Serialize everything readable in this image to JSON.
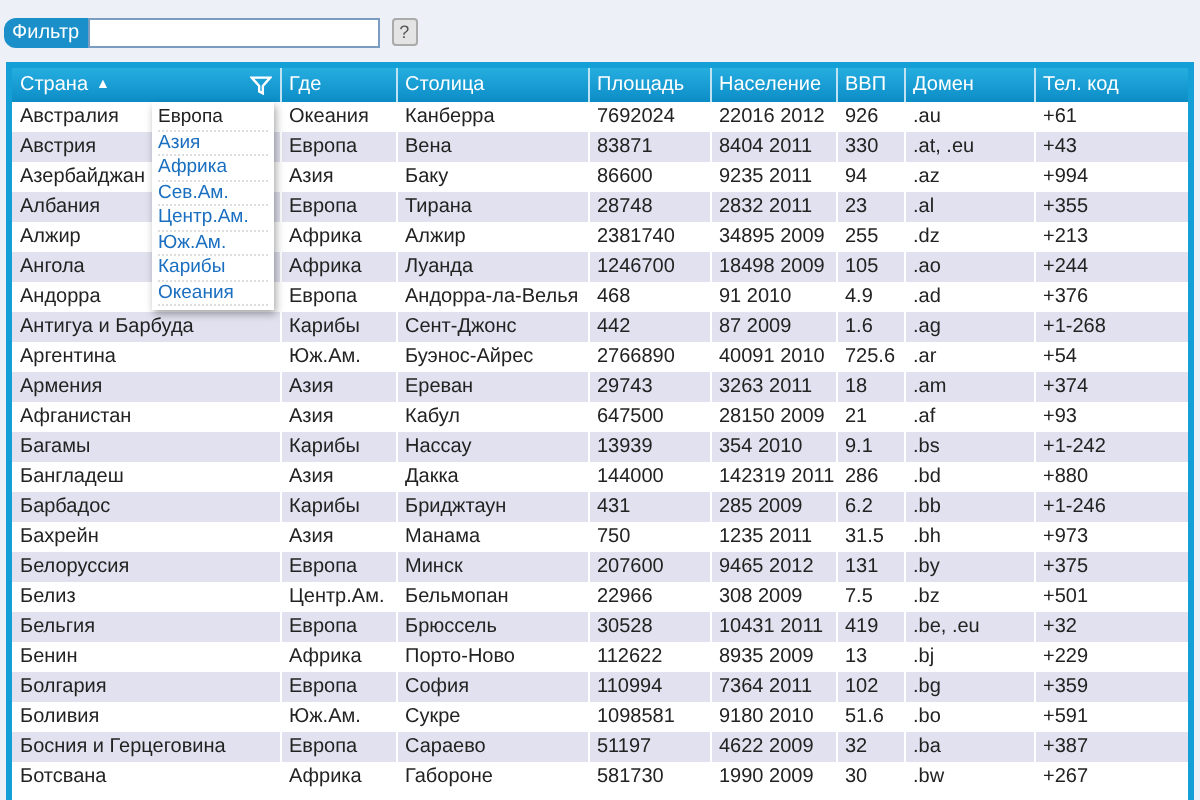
{
  "filter": {
    "label": "Фильтр",
    "help": "?"
  },
  "columns": [
    {
      "label": "Страна",
      "sort_mark": "▲",
      "filter": true
    },
    {
      "label": "Где",
      "filter": false
    },
    {
      "label": "Столица",
      "filter": false
    },
    {
      "label": "Площадь",
      "filter": false
    },
    {
      "label": "Население",
      "filter": false
    },
    {
      "label": "ВВП",
      "filter": false
    },
    {
      "label": "Домен",
      "filter": false
    },
    {
      "label": "Тел. код",
      "filter": false
    }
  ],
  "filter_menu": [
    {
      "label": "Европа",
      "selected": true
    },
    {
      "label": "Азия",
      "selected": false
    },
    {
      "label": "Африка",
      "selected": false
    },
    {
      "label": "Сев.Ам.",
      "selected": false
    },
    {
      "label": "Центр.Ам.",
      "selected": false
    },
    {
      "label": "Юж.Ам.",
      "selected": false
    },
    {
      "label": "Карибы",
      "selected": false
    },
    {
      "label": "Океания",
      "selected": false
    }
  ],
  "rows": [
    [
      "Австралия",
      "Океания",
      "Канберра",
      "7692024",
      "22016 2012",
      "926",
      ".au",
      "+61"
    ],
    [
      "Австрия",
      "Европа",
      "Вена",
      "83871",
      "8404 2011",
      "330",
      ".at, .eu",
      "+43"
    ],
    [
      "Азербайджан",
      "Азия",
      "Баку",
      "86600",
      "9235 2011",
      "94",
      ".az",
      "+994"
    ],
    [
      "Албания",
      "Европа",
      "Тирана",
      "28748",
      "2832 2011",
      "23",
      ".al",
      "+355"
    ],
    [
      "Алжир",
      "Африка",
      "Алжир",
      "2381740",
      "34895 2009",
      "255",
      ".dz",
      "+213"
    ],
    [
      "Ангола",
      "Африка",
      "Луанда",
      "1246700",
      "18498 2009",
      "105",
      ".ao",
      "+244"
    ],
    [
      "Андорра",
      "Европа",
      "Андорра-ла-Велья",
      "468",
      "91 2010",
      "4.9",
      ".ad",
      "+376"
    ],
    [
      "Антигуа и Барбуда",
      "Карибы",
      "Сент-Джонс",
      "442",
      "87 2009",
      "1.6",
      ".ag",
      "+1-268"
    ],
    [
      "Аргентина",
      "Юж.Ам.",
      "Буэнос-Айрес",
      "2766890",
      "40091 2010",
      "725.6",
      ".ar",
      "+54"
    ],
    [
      "Армения",
      "Азия",
      "Ереван",
      "29743",
      "3263 2011",
      "18",
      ".am",
      "+374"
    ],
    [
      "Афганистан",
      "Азия",
      "Кабул",
      "647500",
      "28150 2009",
      "21",
      ".af",
      "+93"
    ],
    [
      "Багамы",
      "Карибы",
      "Нассау",
      "13939",
      "354 2010",
      "9.1",
      ".bs",
      "+1-242"
    ],
    [
      "Бангладеш",
      "Азия",
      "Дакка",
      "144000",
      "142319 2011",
      "286",
      ".bd",
      "+880"
    ],
    [
      "Барбадос",
      "Карибы",
      "Бриджтаун",
      "431",
      "285 2009",
      "6.2",
      ".bb",
      "+1-246"
    ],
    [
      "Бахрейн",
      "Азия",
      "Манама",
      "750",
      "1235 2011",
      "31.5",
      ".bh",
      "+973"
    ],
    [
      "Белоруссия",
      "Европа",
      "Минск",
      "207600",
      "9465 2012",
      "131",
      ".by",
      "+375"
    ],
    [
      "Белиз",
      "Центр.Ам.",
      "Бельмопан",
      "22966",
      "308 2009",
      "7.5",
      ".bz",
      "+501"
    ],
    [
      "Бельгия",
      "Европа",
      "Брюссель",
      "30528",
      "10431 2011",
      "419",
      ".be, .eu",
      "+32"
    ],
    [
      "Бенин",
      "Африка",
      "Порто-Ново",
      "112622",
      "8935 2009",
      "13",
      ".bj",
      "+229"
    ],
    [
      "Болгария",
      "Европа",
      "София",
      "110994",
      "7364 2011",
      "102",
      ".bg",
      "+359"
    ],
    [
      "Боливия",
      "Юж.Ам.",
      "Сукре",
      "1098581",
      "9180 2010",
      "51.6",
      ".bo",
      "+591"
    ],
    [
      "Босния и Герцеговина",
      "Европа",
      "Сараево",
      "51197",
      "4622 2009",
      "32",
      ".ba",
      "+387"
    ],
    [
      "Ботсвана",
      "Африка",
      "Габороне",
      "581730",
      "1990 2009",
      "30",
      ".bw",
      "+267"
    ]
  ]
}
